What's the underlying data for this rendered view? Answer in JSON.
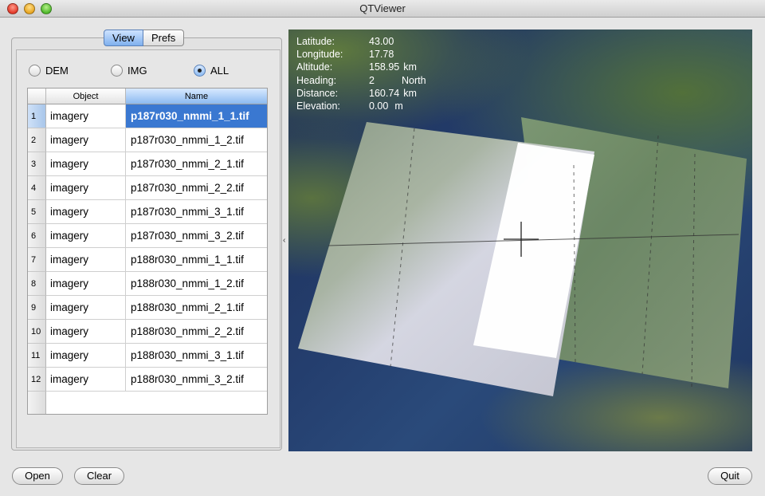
{
  "window": {
    "title": "QTViewer"
  },
  "tabs": {
    "view": "View",
    "prefs": "Prefs"
  },
  "filter": {
    "options": [
      "DEM",
      "IMG",
      "ALL"
    ],
    "selected": "ALL"
  },
  "table": {
    "columns": [
      "Object",
      "Name"
    ],
    "selected_row": 1,
    "rows": [
      {
        "num": "1",
        "object": "imagery",
        "name": "p187r030_nmmi_1_1.tif"
      },
      {
        "num": "2",
        "object": "imagery",
        "name": "p187r030_nmmi_1_2.tif"
      },
      {
        "num": "3",
        "object": "imagery",
        "name": "p187r030_nmmi_2_1.tif"
      },
      {
        "num": "4",
        "object": "imagery",
        "name": "p187r030_nmmi_2_2.tif"
      },
      {
        "num": "5",
        "object": "imagery",
        "name": "p187r030_nmmi_3_1.tif"
      },
      {
        "num": "6",
        "object": "imagery",
        "name": "p187r030_nmmi_3_2.tif"
      },
      {
        "num": "7",
        "object": "imagery",
        "name": "p188r030_nmmi_1_1.tif"
      },
      {
        "num": "8",
        "object": "imagery",
        "name": "p188r030_nmmi_1_2.tif"
      },
      {
        "num": "9",
        "object": "imagery",
        "name": "p188r030_nmmi_2_1.tif"
      },
      {
        "num": "10",
        "object": "imagery",
        "name": "p188r030_nmmi_2_2.tif"
      },
      {
        "num": "11",
        "object": "imagery",
        "name": "p188r030_nmmi_3_1.tif"
      },
      {
        "num": "12",
        "object": "imagery",
        "name": "p188r030_nmmi_3_2.tif"
      }
    ]
  },
  "hud": {
    "latitude": {
      "label": "Latitude:",
      "value": "43.00"
    },
    "longitude": {
      "label": "Longitude:",
      "value": "17.78"
    },
    "altitude": {
      "label": "Altitude:",
      "value": "158.95",
      "unit": "km"
    },
    "heading": {
      "label": "Heading:",
      "value": "2",
      "unit": "North"
    },
    "distance": {
      "label": "Distance:",
      "value": "160.74",
      "unit": "km"
    },
    "elevation": {
      "label": "Elevation:",
      "value": "0.00",
      "unit": "m"
    }
  },
  "buttons": {
    "open": "Open",
    "clear": "Clear",
    "quit": "Quit"
  },
  "colors": {
    "selection": "#3a78d1",
    "ocean": "#243e6e",
    "land": "#5f7a3e"
  }
}
